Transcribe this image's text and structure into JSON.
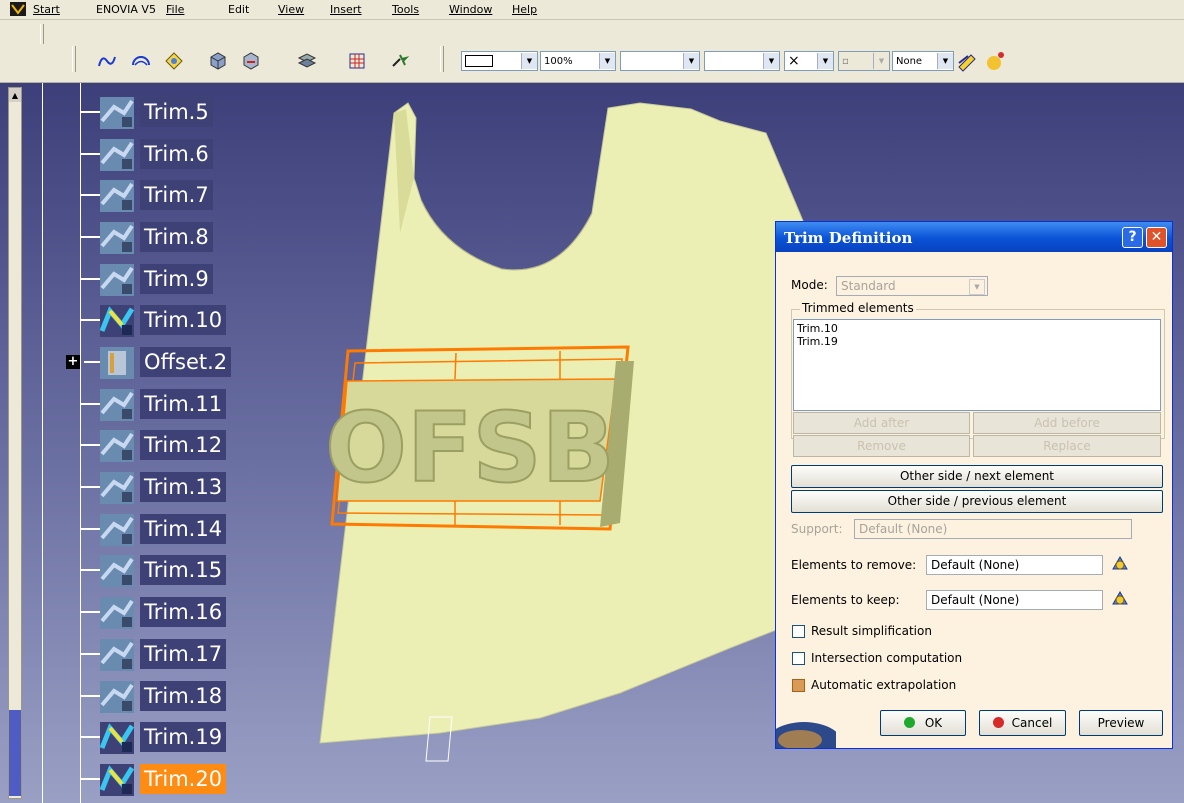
{
  "menubar": {
    "items": [
      "Start",
      "ENOVIA V5",
      "File",
      "Edit",
      "View",
      "Insert",
      "Tools",
      "Window",
      "Help"
    ]
  },
  "toolbar": {
    "combo_color": "",
    "combo_transparency": "100%",
    "combo_thickness": "",
    "combo_linetype": "",
    "combo_point": "×",
    "combo_layer": "None",
    "icons": [
      "spline-icon",
      "circle-icon",
      "corner-icon",
      "cube-icon",
      "join-icon",
      "heal-icon",
      "transform-icon",
      "mesh-icon",
      "explode-icon",
      "layer-filter-icon",
      "painter-icon",
      "apply-material-icon"
    ]
  },
  "tree": {
    "nodes": [
      {
        "label": "Trim.5",
        "icon": "trim-icon",
        "selected": false
      },
      {
        "label": "Trim.6",
        "icon": "trim-icon",
        "selected": false
      },
      {
        "label": "Trim.7",
        "icon": "trim-icon",
        "selected": false
      },
      {
        "label": "Trim.8",
        "icon": "trim-icon",
        "selected": false
      },
      {
        "label": "Trim.9",
        "icon": "trim-icon",
        "selected": false
      },
      {
        "label": "Trim.10",
        "icon": "trim-visible-icon",
        "selected": false
      },
      {
        "label": "Offset.2",
        "icon": "offset-icon",
        "selected": false
      },
      {
        "label": "Trim.11",
        "icon": "trim-icon",
        "selected": false
      },
      {
        "label": "Trim.12",
        "icon": "trim-icon",
        "selected": false
      },
      {
        "label": "Trim.13",
        "icon": "trim-icon",
        "selected": false
      },
      {
        "label": "Trim.14",
        "icon": "trim-icon",
        "selected": false
      },
      {
        "label": "Trim.15",
        "icon": "trim-icon",
        "selected": false
      },
      {
        "label": "Trim.16",
        "icon": "trim-icon",
        "selected": false
      },
      {
        "label": "Trim.17",
        "icon": "trim-icon",
        "selected": false
      },
      {
        "label": "Trim.18",
        "icon": "trim-icon",
        "selected": false
      },
      {
        "label": "Trim.19",
        "icon": "trim-visible-icon",
        "selected": false
      },
      {
        "label": "Trim.20",
        "icon": "trim-visible-icon",
        "selected": true
      }
    ]
  },
  "model": {
    "embossed_text": "OFSB"
  },
  "dialog": {
    "title": "Trim Definition",
    "help_label": "?",
    "close_label": "✕",
    "mode_label": "Mode:",
    "mode_value": "Standard",
    "trimmed_group_label": "Trimmed elements",
    "trimmed_elements": [
      "Trim.10",
      "Trim.19"
    ],
    "add_after": "Add after",
    "add_before": "Add before",
    "remove": "Remove",
    "replace": "Replace",
    "other_side_next": "Other side / next element",
    "other_side_previous": "Other side / previous element",
    "support_label": "Support:",
    "support_value": "Default (None)",
    "elements_to_remove_label": "Elements to remove:",
    "elements_to_remove_value": "Default (None)",
    "elements_to_keep_label": "Elements to keep:",
    "elements_to_keep_value": "Default (None)",
    "result_simplification": "Result simplification",
    "result_simplification_checked": false,
    "intersection_computation": "Intersection computation",
    "intersection_computation_checked": false,
    "automatic_extrapolation": "Automatic extrapolation",
    "automatic_extrapolation_checked": true,
    "ok": "OK",
    "cancel": "Cancel",
    "preview": "Preview"
  },
  "colors": {
    "surface": "#ecefb4",
    "selection": "#ff7a00",
    "titlebar": "#0a52d6"
  }
}
